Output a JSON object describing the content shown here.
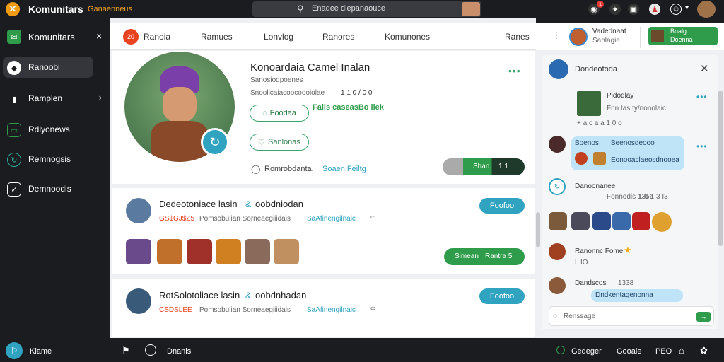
{
  "topbar": {
    "logo_icon": "x-logo-icon",
    "app_name": "Komunitars",
    "app_subtitle": "Ganaenneus",
    "search_text": "Enadee diepanaouce",
    "icons": [
      "camera-icon",
      "notification-icon",
      "puzzle-icon",
      "image-icon",
      "profile-icon",
      "settings-icon"
    ],
    "notification_badge": "1",
    "dropdown": "▾"
  },
  "sidebar": {
    "title": "Komunitars",
    "close_label": "×",
    "items": [
      {
        "label": "Ranoobi",
        "icon": "compass-icon"
      },
      {
        "label": "Ramplen",
        "icon": "bag-icon"
      },
      {
        "label": "Rdlyonews",
        "icon": "chat-icon"
      },
      {
        "label": "Remnogsis",
        "icon": "refresh-icon"
      },
      {
        "label": "Demnoodis",
        "icon": "checkbox-icon"
      }
    ]
  },
  "tabs": {
    "active_badge": "20",
    "items": [
      "Ranoia",
      "Ramues",
      "Lonvlog",
      "Ranores",
      "Komunones",
      "Ranes"
    ]
  },
  "right_header": {
    "name": "Vadednaat",
    "sub": "Sanlagie",
    "action_title": "Bnalg",
    "action_sub": "Doenna"
  },
  "profile": {
    "name": "Konoardaia Camel Inalan",
    "sub": "Sanosiodpoenes",
    "stats": "Snoolicaiacoocoooiolae",
    "stats_nums": "1  1 0 / 0 0",
    "follow_label": "Foodaa",
    "follow_sub": "Falls caseasBo ilek",
    "second_label": "Sanlonas",
    "footer_text": "Romrobdanta.",
    "footer_link": "Soaen Feiltg",
    "action_btn": "Shan",
    "action_count": "1 1"
  },
  "posts": [
    {
      "title": "Dedeotoniace lasin",
      "author": "oobdniodan",
      "meta": "GS$GJ$Z5",
      "text": "Pomsobulian Sorneaegiiidais",
      "link": "SaAfinengilnaic",
      "btn": "Foofoo",
      "action_btn": "Simean",
      "action_count": "Rantra 5"
    },
    {
      "title": "RotSolotoliace lasin",
      "author": "oobdnhadan",
      "meta": "CSDSLEE",
      "text": "Pomsobulian Sorneaegiiidais",
      "link": "SaAfinengilnaic",
      "btn": "Foofoo"
    }
  ],
  "chat": {
    "header": "Dondeofoda",
    "items": [
      {
        "name": "Pidodlay",
        "text": "Fnn tas ty/nonolaic",
        "meta": "+ a c a a 1 0 o"
      },
      {
        "name": "Boenos",
        "text": "Beenosdeooo",
        "bubble_text": "Eonooaclaeosdnooea"
      },
      {
        "name": "Danoonanee",
        "text": "Fonnodis 1356",
        "meta": "1 0 1 3  I3"
      },
      {
        "name": "Ranonnc Fome",
        "text": "L IO",
        "meta": ""
      },
      {
        "name": "Dandscos",
        "text": "1338",
        "bubble_text": "Dndkentagenonna"
      }
    ],
    "input_placeholder": "Renssage",
    "send_label": "→"
  },
  "bottombar": {
    "brand": "Klame",
    "label": "Dnanis",
    "right_items": [
      "Gedeger",
      "Gooaie",
      "PEO"
    ]
  },
  "colors": {
    "accent": "#2fa3c0",
    "green": "#2e9c4a",
    "brand": "#f39c12",
    "dark": "#1b1c20"
  }
}
